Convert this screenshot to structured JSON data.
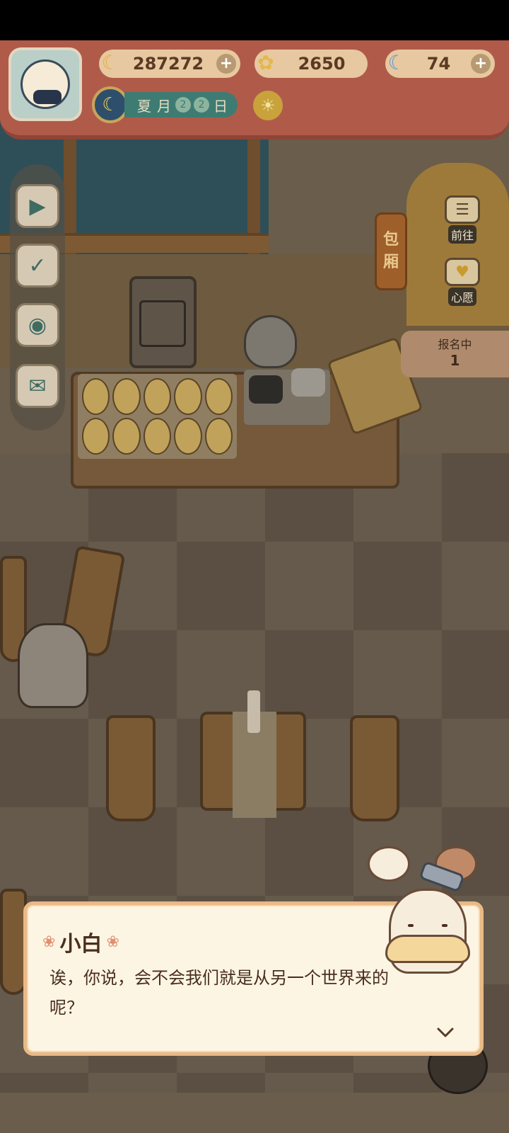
{
  "resources": {
    "banana": {
      "value": "287272",
      "icon": "banana-icon"
    },
    "clover": {
      "value": "2650",
      "icon": "clover-icon"
    },
    "blue_banana": {
      "value": "74",
      "icon": "blue-banana-icon"
    }
  },
  "date": {
    "season": "夏",
    "month": "月",
    "d1": "2",
    "d2": "2",
    "day": "日"
  },
  "side_sign": [
    "包",
    "厢"
  ],
  "side_buttons": {
    "goto": "前往",
    "wish": "心愿"
  },
  "signup": {
    "label": "报名中",
    "count": "1"
  },
  "dialog": {
    "speaker": "小白",
    "text": "诶，你说，会不会我们就是从另一个世界来的呢？"
  },
  "colors": {
    "banner": "#b05b49",
    "dialog_bg": "#fdf5e4",
    "dialog_border": "#e9b986"
  }
}
